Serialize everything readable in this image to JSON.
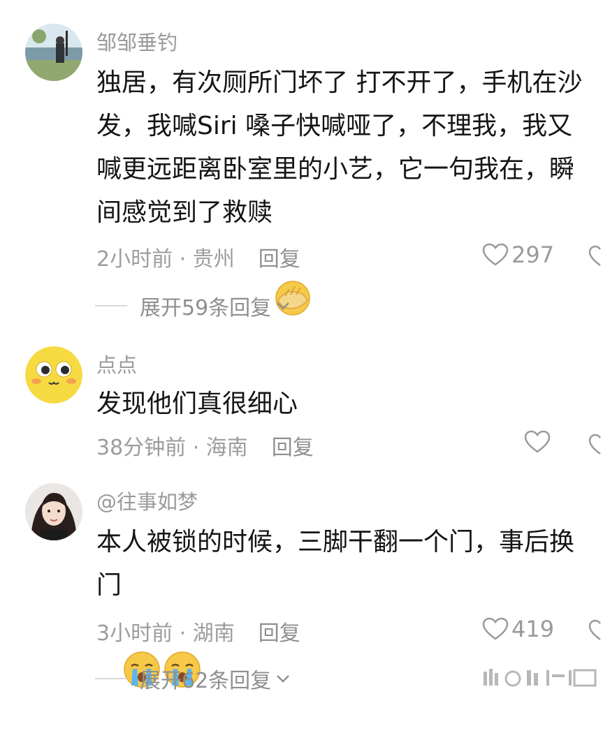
{
  "comments": [
    {
      "username": "邹邹垂钓",
      "text_lines": [
        "独居，有次厕所门坏了 打不开了，手机在沙",
        "发，我喊Siri 嗓子快喊哑了，不理我，我又",
        "喊更远距离卧室里的小艺，它一句我在，瞬",
        "间感觉到了救赎"
      ],
      "emoji": "facepalm-emoji",
      "time": "2小时前",
      "location": "贵州",
      "reply": "回复",
      "likes": "297",
      "expand": "展开59条回复"
    },
    {
      "username": "点点",
      "text_lines": [
        "发现他们真很细心"
      ],
      "time": "38分钟前",
      "location": "海南",
      "reply": "回复",
      "likes": "",
      "expand": ""
    },
    {
      "username": "@往事如梦",
      "text_lines": [
        "本人被锁的时候，三脚干翻一个门，事后换",
        "门"
      ],
      "emoji": "crying-emoji",
      "time": "3小时前",
      "location": "湖南",
      "reply": "回复",
      "likes": "419",
      "expand": "展开62条回复"
    }
  ],
  "separator": " · ",
  "icons": {
    "like": "heart-icon",
    "dislike": "broken-heart-icon",
    "expand": "chevron-down-icon"
  },
  "colors": {
    "text": "#151515",
    "muted": "#9a9a9a",
    "background": "#ffffff"
  }
}
